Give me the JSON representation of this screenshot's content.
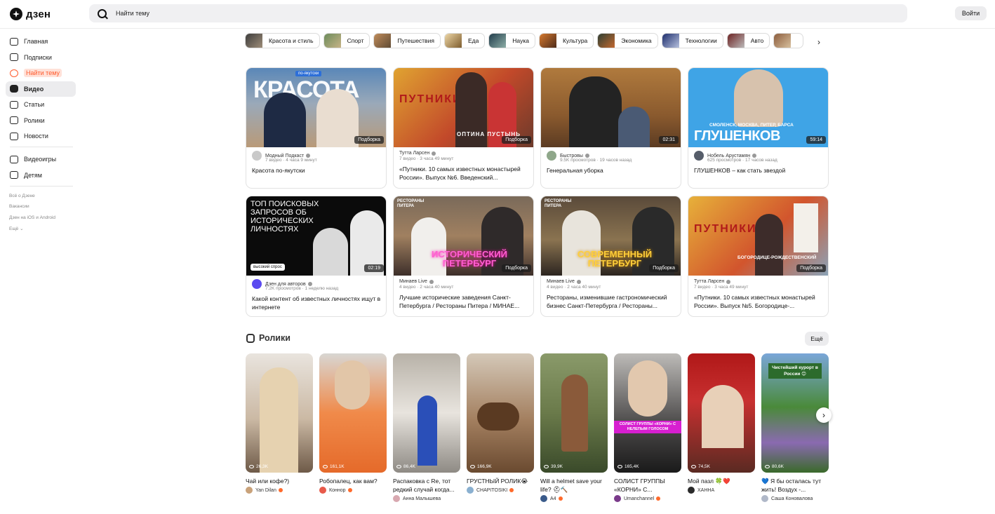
{
  "header": {
    "logo_text": "дзен",
    "search_placeholder": "Найти тему",
    "login_label": "Войти"
  },
  "sidebar": {
    "items": [
      {
        "label": "Главная",
        "icon": "home-icon"
      },
      {
        "label": "Подписки",
        "icon": "subscriptions-icon"
      },
      {
        "label": "Найти тему",
        "icon": "find-topic-icon",
        "highlight": true
      },
      {
        "label": "Видео",
        "icon": "video-icon",
        "active": true
      },
      {
        "label": "Статьи",
        "icon": "articles-icon"
      },
      {
        "label": "Ролики",
        "icon": "shorts-icon"
      },
      {
        "label": "Новости",
        "icon": "news-icon"
      }
    ],
    "items2": [
      {
        "label": "Видеоигры",
        "icon": "gamepad-icon"
      },
      {
        "label": "Детям",
        "icon": "kids-icon"
      }
    ],
    "footer": [
      "Всё о Дзене",
      "Вакансии",
      "Дзен на iOS и Android",
      "Ещё ⌄"
    ]
  },
  "categories": [
    "Красота и стиль",
    "Спорт",
    "Путешествия",
    "Еда",
    "Наука",
    "Культура",
    "Экономика",
    "Технологии",
    "Авто"
  ],
  "videos": [
    {
      "author": "Модный Подкаст",
      "stats": "7 видео · 4 часа 9 минут",
      "title": "Красота по-якутски",
      "badge": "Подборка",
      "overlay": "КРАСОТА",
      "sub": "по-якутски"
    },
    {
      "author": "Тутта Ларсен",
      "stats": "7 видео · 3 часа 49 минут",
      "title": "«Путники. 10 самых известных монастырей России». Выпуск №6. Введенский...",
      "badge": "Подборка",
      "overlay": "ПУТНИКИ",
      "sub": "ОПТИНА ПУСТЫНЬ"
    },
    {
      "author": "Быстровы",
      "stats": "9.5K просмотров · 19 часов назад",
      "title": "Генеральная уборка",
      "badge": "02:31",
      "overlay": "",
      "sub": ""
    },
    {
      "author": "Нобель Арустамян",
      "stats": "625 просмотров · 17 часов назад",
      "title": "ГЛУШЕНКОВ – как стать звездой",
      "badge": "59:14",
      "overlay": "ГЛУШЕНКОВ",
      "sub": "СМОЛЕНСК, МОСКВА, ПИТЕР, БАРСА"
    },
    {
      "author": "Дзен для авторов",
      "stats": "7.2K просмотров · 1 неделю назад",
      "title": "Какой контент об известных личностях ищут в интернете",
      "badge": "02:19",
      "overlay": "ТОП ПОИСКОВЫХ ЗАПРОСОВ ОБ ИСТОРИЧЕСКИХ ЛИЧНОСТЯХ",
      "sub": "",
      "tag": "высокий спрос"
    },
    {
      "author": "Минаев Live",
      "stats": "4 видео · 2 часа 40 минут",
      "title": "Лучшие исторические заведения Санкт-Петербурга / Рестораны Питера / МИНАЕ...",
      "badge": "Подборка",
      "overlay": "ИСТОРИЧЕСКИЙ ПЕТЕРБУРГ",
      "sub": "РЕСТОРАНЫ ПИТЕРА"
    },
    {
      "author": "Минаев Live",
      "stats": "4 видео · 2 часа 40 минут",
      "title": "Рестораны, изменившие гастрономический бизнес Санкт-Петербурга / Рестораны...",
      "badge": "Подборка",
      "overlay": "СОВРЕМЕННЫЙ ПЕТЕРБУРГ",
      "sub": "РЕСТОРАНЫ ПИТЕРА"
    },
    {
      "author": "Тутта Ларсен",
      "stats": "7 видео · 3 часа 49 минут",
      "title": "«Путники. 10 самых известных монастырей России». Выпуск №5. Богородице-...",
      "badge": "Подборка",
      "overlay": "ПУТНИКИ",
      "sub": "БОГОРОДИЦЕ-РОЖДЕСТВЕНСКИЙ"
    }
  ],
  "shorts_section": {
    "title": "Ролики",
    "more_label": "Ещё"
  },
  "shorts": [
    {
      "views": "26,3K",
      "title": "Чай или кофе?)",
      "author": "Yan Dilan"
    },
    {
      "views": "161,1K",
      "title": "Робопалец, как вам?",
      "author": "Коннор"
    },
    {
      "views": "86,4K",
      "title": "Распаковка с Re, тот редкий случай когда...",
      "author": "Анна Малышева"
    },
    {
      "views": "166,9K",
      "title": "ГРУСТНЫЙ РОЛИК😭",
      "author": "CHAPITOSIKI"
    },
    {
      "views": "39,9K",
      "title": "Will a helmet save your life? ⛑🔨",
      "author": "A4"
    },
    {
      "views": "165,4K",
      "title": "СОЛИСТ ГРУППЫ «КОРНИ» С...",
      "author": "Umanchannel",
      "overlay": "СОЛИСТ ГРУППЫ «КОРНИ» С НЕЛЕПЫМ ГОЛОСОМ"
    },
    {
      "views": "74,5K",
      "title": "Мой пазл 🍀❤️",
      "author": "ХАННА"
    },
    {
      "views": "80,6K",
      "title": "💙 Я бы осталась тут жить! Воздух -...",
      "author": "Саша Коновалова",
      "overlay": "Чистейший курорт в России 😊"
    }
  ]
}
